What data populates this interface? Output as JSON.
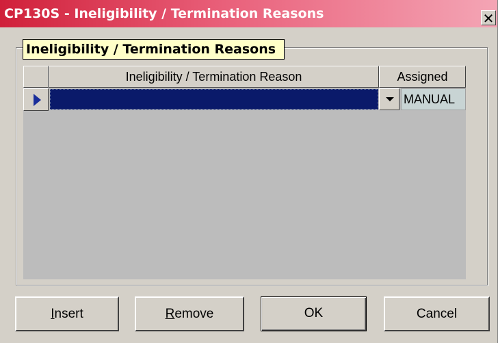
{
  "window": {
    "title": "CP130S - Ineligibility / Termination Reasons",
    "close_glyph": "✕"
  },
  "group": {
    "label": "Ineligibility / Termination Reasons"
  },
  "grid": {
    "columns": [
      "Ineligibility / Termination Reason",
      "Assigned"
    ],
    "rows": [
      {
        "reason": "",
        "assigned": "MANUAL"
      }
    ]
  },
  "buttons": {
    "insert": {
      "label": "Insert",
      "mnemonic": "I"
    },
    "remove": {
      "label": "Remove",
      "mnemonic": "R"
    },
    "ok": {
      "label": "OK"
    },
    "cancel": {
      "label": "Cancel"
    }
  },
  "colors": {
    "titlebar_start": "#d0203a",
    "titlebar_end": "#f4a5b5",
    "group_label_bg": "#ffffc8",
    "selected_cell": "#0a1a6a",
    "row_indicator": "#1a2e9a",
    "face": "#d4d0c8"
  },
  "icons": {
    "row_indicator": "triangle-right",
    "dropdown": "triangle-down",
    "close": "x-mark"
  }
}
